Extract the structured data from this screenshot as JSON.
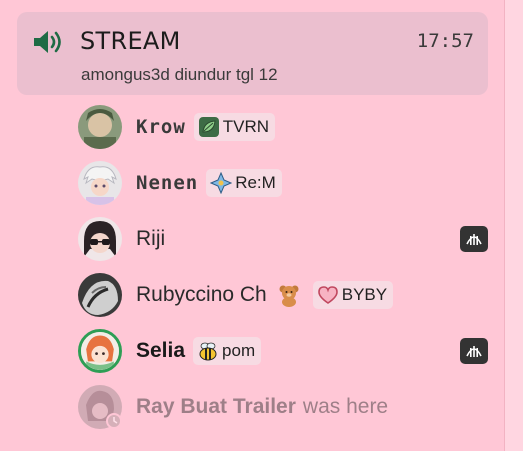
{
  "channel": {
    "name": "STREAM",
    "time": "17:57",
    "description": "amongus3d diundur tgl 12",
    "icon": "speaker-icon"
  },
  "members": [
    {
      "name": "Krow",
      "tag": "TVRN",
      "tag_icon": "leaf-icon"
    },
    {
      "name": "Nenen",
      "tag": "Re:M",
      "tag_icon": "sparkle-icon"
    },
    {
      "name": "Riji",
      "activity_icon": "game-activity-icon"
    },
    {
      "name": "Rubyccino Ch",
      "emoji": "teddy-bear-emoji",
      "tag": "BYBY",
      "tag_icon": "heart-icon"
    },
    {
      "name": "Selia",
      "tag": "pom",
      "tag_icon": "bee-icon",
      "activity_icon": "game-activity-icon"
    }
  ],
  "departed": {
    "name": "Ray Buat Trailer",
    "suffix": "was here"
  },
  "colors": {
    "background": "#ffc7d6",
    "channel_card": "#ebbfcf",
    "speaker_green": "#1f6b45",
    "activity_badge": "#333333"
  }
}
